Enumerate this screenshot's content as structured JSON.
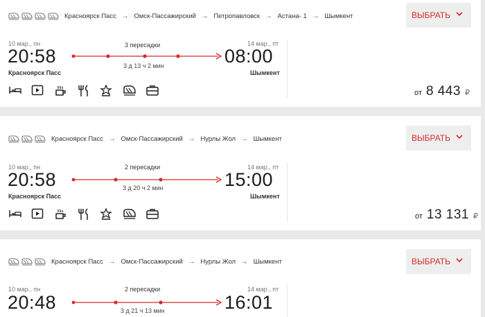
{
  "currency": "₽",
  "from_label": "от",
  "select_label": "ВЫБРАТЬ",
  "accent_color": "#d42b2b",
  "results": [
    {
      "route": [
        "Красноярск Пасс",
        "Омск-Пассажирский",
        "Петропавловск",
        "Астана- 1",
        "Шымкент"
      ],
      "dep_date": "10 мар., пн",
      "dep_time": "20:58",
      "dep_station": "Красноярск Пасс",
      "arr_date": "14 мар., пт",
      "arr_time": "08:00",
      "arr_station": "Шымкент",
      "transfers": "3 пересадки",
      "transfer_count": 3,
      "duration": "3 д 13 ч 2 мин",
      "price": "8 443",
      "amenities": [
        "bed-icon",
        "play-video-icon",
        "coffee-icon",
        "restaurant-icon",
        "star-award-icon",
        "train-icon",
        "briefcase-icon"
      ]
    },
    {
      "route": [
        "Красноярск Пасс",
        "Омск-Пассажирский",
        "Нурлы Жол",
        "Шымкент"
      ],
      "dep_date": "10 мар., пн",
      "dep_time": "20:58",
      "dep_station": "Красноярск Пасс",
      "arr_date": "14 мар., пт",
      "arr_time": "15:00",
      "arr_station": "Шымкент",
      "transfers": "2 пересадки",
      "transfer_count": 2,
      "duration": "3 д 20 ч 2 мин",
      "price": "13 131",
      "amenities": [
        "bed-icon",
        "play-video-icon",
        "coffee-icon",
        "restaurant-icon",
        "star-award-icon",
        "train-icon",
        "briefcase-icon"
      ]
    },
    {
      "route": [
        "Красноярск Пасс",
        "Омск-Пассажирский",
        "Нурлы Жол",
        "Шымкент"
      ],
      "dep_date": "10 мар., пн",
      "dep_time": "20:48",
      "arr_date": "14 мар., пт",
      "arr_time": "16:01",
      "transfers": "2 пересадки",
      "transfer_count": 2,
      "duration": "3 д 21 ч 13 мин"
    }
  ]
}
